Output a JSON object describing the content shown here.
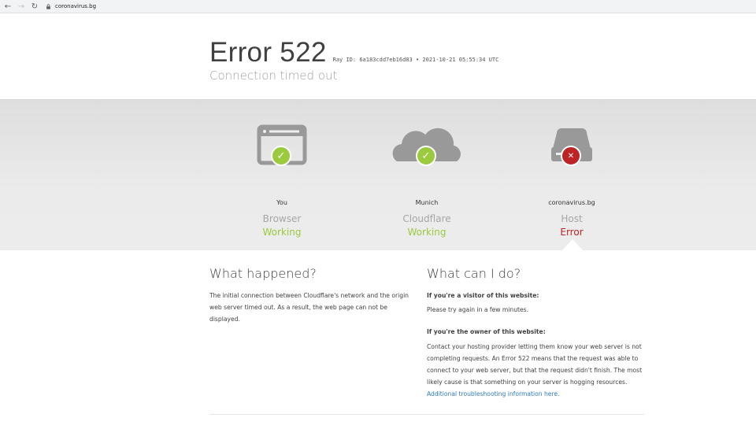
{
  "browser": {
    "url": "coronavirus.bg",
    "back_icon": "back-arrow-icon",
    "forward_icon": "forward-arrow-icon",
    "reload_icon": "reload-icon"
  },
  "header": {
    "title": "Error 522",
    "ray": "Ray ID: 6a183cdd7eb16d83 • 2021-10-21 05:55:34 UTC",
    "subtitle": "Connection timed out"
  },
  "status": [
    {
      "location": "You",
      "role": "Browser",
      "state": "Working",
      "ok": true,
      "icon": "browser-window-icon"
    },
    {
      "location": "Munich",
      "role": "Cloudflare",
      "state": "Working",
      "ok": true,
      "icon": "cloud-icon"
    },
    {
      "location": "coronavirus.bg",
      "role": "Host",
      "state": "Error",
      "ok": false,
      "icon": "server-icon"
    }
  ],
  "what_happened": {
    "title": "What happened?",
    "body": "The initial connection between Cloudflare's network and the origin web server timed out. As a result, the web page can not be displayed."
  },
  "what_can_i_do": {
    "title": "What can I do?",
    "visitor_heading": "If you're a visitor of this website:",
    "visitor_text": "Please try again in a few minutes.",
    "owner_heading": "If you're the owner of this website:",
    "owner_text": "Contact your hosting provider letting them know your web server is not completing requests. An Error 522 means that the request was able to connect to your web server, but that the request didn't finish. The most likely cause is that something on your server is hogging resources.",
    "owner_link": "Additional troubleshooting information here."
  },
  "colors": {
    "ok": "#9bca3e",
    "error": "#bd2426",
    "icon_gray": "#999999"
  }
}
